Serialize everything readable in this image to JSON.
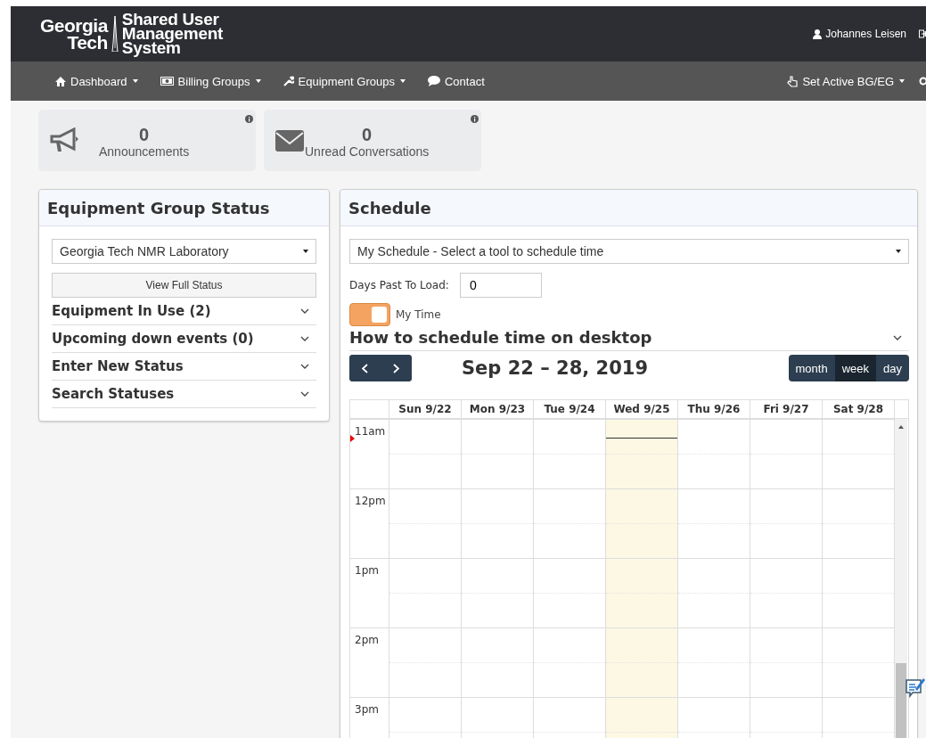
{
  "header": {
    "logo": {
      "left_lines": [
        "Georgia",
        "Tech"
      ],
      "right_lines": [
        "Shared User",
        "Management",
        "System"
      ]
    },
    "user": "Johannes Leisen"
  },
  "nav": {
    "items": [
      {
        "label": "Dashboard",
        "dropdown": true
      },
      {
        "label": "Billing Groups",
        "dropdown": true
      },
      {
        "label": "Equipment Groups",
        "dropdown": true
      },
      {
        "label": "Contact",
        "dropdown": false
      }
    ],
    "right_items": [
      {
        "label": "Set Active BG/EG",
        "dropdown": true
      }
    ]
  },
  "info_cards": [
    {
      "count": "0",
      "label": "Announcements"
    },
    {
      "count": "0",
      "label": "Unread Conversations"
    }
  ],
  "equipment_status": {
    "title": "Equipment Group Status",
    "group_select": "Georgia Tech NMR Laboratory",
    "button": "View Full Status",
    "sections": [
      {
        "label": "Equipment In Use (2)",
        "expanded": false
      },
      {
        "label": "Upcoming down events (0)",
        "expanded": false
      },
      {
        "label": "Enter New Status",
        "expanded": false
      },
      {
        "label": "Search Statuses",
        "expanded": false
      }
    ]
  },
  "schedule": {
    "title": "Schedule",
    "tool_select": "My Schedule - Select a tool to schedule time",
    "days_past_label": "Days Past To Load:",
    "days_past_value": "0",
    "my_time": {
      "label": "My Time",
      "on": true
    },
    "help": {
      "label": "How to schedule time on desktop",
      "expanded": false
    },
    "calendar": {
      "range": "Sep 22 – 28, 2019",
      "views": [
        {
          "label": "month",
          "selected": false
        },
        {
          "label": "week",
          "selected": true
        },
        {
          "label": "day",
          "selected": false
        }
      ],
      "days": [
        {
          "label": "Sun 9/22",
          "today": false
        },
        {
          "label": "Mon 9/23",
          "today": false
        },
        {
          "label": "Tue 9/24",
          "today": false
        },
        {
          "label": "Wed 9/25",
          "today": true
        },
        {
          "label": "Thu 9/26",
          "today": false
        },
        {
          "label": "Fri 9/27",
          "today": false
        },
        {
          "label": "Sat 9/28",
          "today": false
        }
      ],
      "hours": [
        "11am",
        "12pm",
        "1pm",
        "2pm",
        "3pm"
      ]
    }
  }
}
